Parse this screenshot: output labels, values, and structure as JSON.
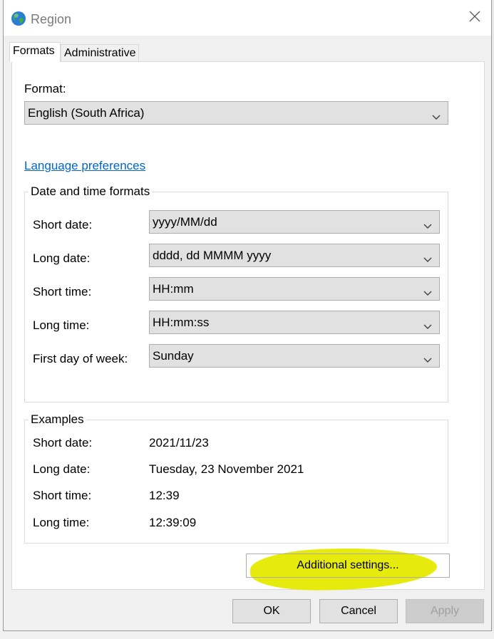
{
  "window": {
    "title": "Region"
  },
  "tabs": [
    {
      "label": "Formats",
      "active": true
    },
    {
      "label": "Administrative",
      "active": false
    }
  ],
  "format": {
    "label": "Format:",
    "value": "English (South Africa)"
  },
  "language_preferences": {
    "label": "Language preferences"
  },
  "date_time_formats": {
    "title": "Date and time formats",
    "rows": [
      {
        "label": "Short date:",
        "value": "yyyy/MM/dd"
      },
      {
        "label": "Long date:",
        "value": "dddd, dd MMMM yyyy"
      },
      {
        "label": "Short time:",
        "value": "HH:mm"
      },
      {
        "label": "Long time:",
        "value": "HH:mm:ss"
      },
      {
        "label": "First day of week:",
        "value": "Sunday"
      }
    ]
  },
  "examples": {
    "title": "Examples",
    "rows": [
      {
        "label": "Short date:",
        "value": "2021/11/23"
      },
      {
        "label": "Long date:",
        "value": "Tuesday, 23 November 2021"
      },
      {
        "label": "Short time:",
        "value": "12:39"
      },
      {
        "label": "Long time:",
        "value": "12:39:09"
      }
    ]
  },
  "buttons": {
    "additional_settings": "Additional settings...",
    "ok": "OK",
    "cancel": "Cancel",
    "apply": "Apply"
  },
  "colors": {
    "link": "#0066cc",
    "highlight": "#e6ea00",
    "button_face": "#e1e1e1",
    "disabled_text": "#a0a0a0"
  },
  "icons": {
    "app": "globe-icon",
    "close": "close-icon",
    "dropdown": "chevron-down-icon"
  }
}
